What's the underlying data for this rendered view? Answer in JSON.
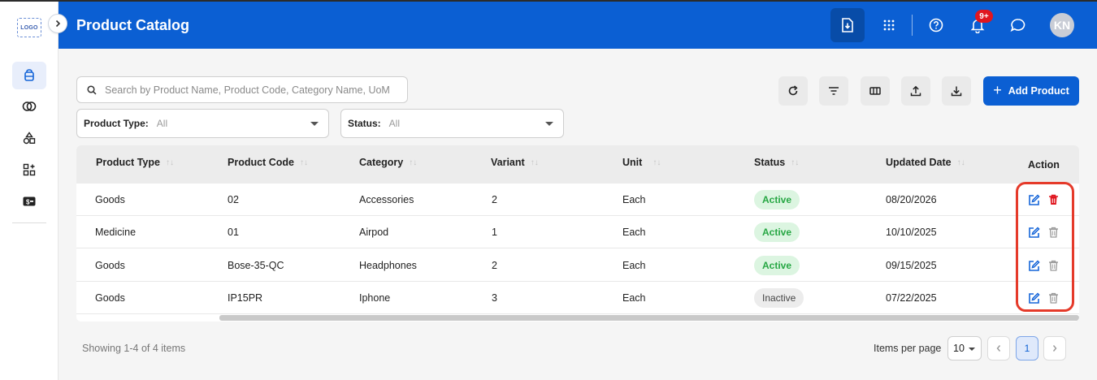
{
  "rail": {
    "logo_text": "LOGO",
    "items": [
      {
        "icon": "product-box-icon",
        "active": true
      },
      {
        "icon": "rings-icon",
        "active": false
      },
      {
        "icon": "shapes-icon",
        "active": false
      },
      {
        "icon": "grid-plus-icon",
        "active": false
      },
      {
        "icon": "money-icon",
        "active": false
      }
    ]
  },
  "header": {
    "title": "Product Catalog",
    "notification_badge": "9+",
    "avatar_initials": "KN"
  },
  "search": {
    "placeholder": "Search by Product Name, Product Code, Category Name, UoM"
  },
  "filters": {
    "product_type": {
      "label": "Product Type:",
      "value": "All"
    },
    "status": {
      "label": "Status:",
      "value": "All"
    }
  },
  "toolbar": {
    "add_label": "Add Product"
  },
  "table": {
    "columns": [
      "Product Type",
      "Product Code",
      "Category",
      "Variant",
      "Unit",
      "Status",
      "Updated Date",
      "Action"
    ],
    "rows": [
      {
        "type": "Goods",
        "code": "02",
        "category": "Accessories",
        "variant": "2",
        "unit": "Each",
        "status": "Active",
        "updated": "08/20/2026"
      },
      {
        "type": "Medicine",
        "code": "01",
        "category": "Airpod",
        "variant": "1",
        "unit": "Each",
        "status": "Active",
        "updated": "10/10/2025"
      },
      {
        "type": "Goods",
        "code": "Bose-35-QC",
        "category": "Headphones",
        "variant": "2",
        "unit": "Each",
        "status": "Active",
        "updated": "09/15/2025"
      },
      {
        "type": "Goods",
        "code": "IP15PR",
        "category": "Iphone",
        "variant": "3",
        "unit": "Each",
        "status": "Inactive",
        "updated": "07/22/2025"
      }
    ]
  },
  "footer": {
    "showing": "Showing 1-4 of 4 items",
    "items_per_page_label": "Items per page",
    "items_per_page_value": "10",
    "current_page": "1"
  },
  "colors": {
    "primary": "#0b5fd3",
    "active_green": "#27a744",
    "delete_red": "#e0161f",
    "highlight": "#e53a2a"
  }
}
